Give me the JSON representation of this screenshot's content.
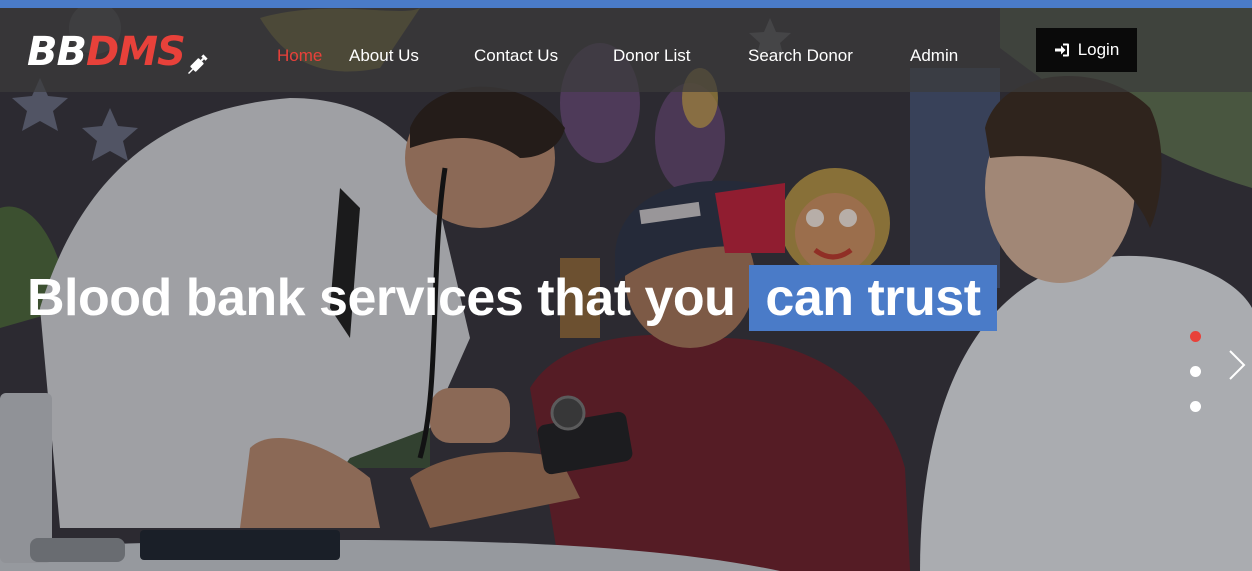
{
  "logo": {
    "part1": "BB",
    "part2": "DMS"
  },
  "nav": {
    "items": [
      {
        "label": "Home",
        "active": true
      },
      {
        "label": "About Us",
        "active": false
      },
      {
        "label": "Contact Us",
        "active": false
      },
      {
        "label": "Donor List",
        "active": false
      },
      {
        "label": "Search Donor",
        "active": false
      },
      {
        "label": "Admin",
        "active": false
      }
    ],
    "login_label": "Login"
  },
  "hero": {
    "headline_main": "Blood bank services that you",
    "headline_highlight": "can trust"
  },
  "carousel": {
    "slide_count": 3,
    "active_index": 0
  },
  "colors": {
    "accent_blue": "#4a7bc8",
    "brand_red": "#e8413a",
    "login_bg": "#0a0a0a"
  }
}
